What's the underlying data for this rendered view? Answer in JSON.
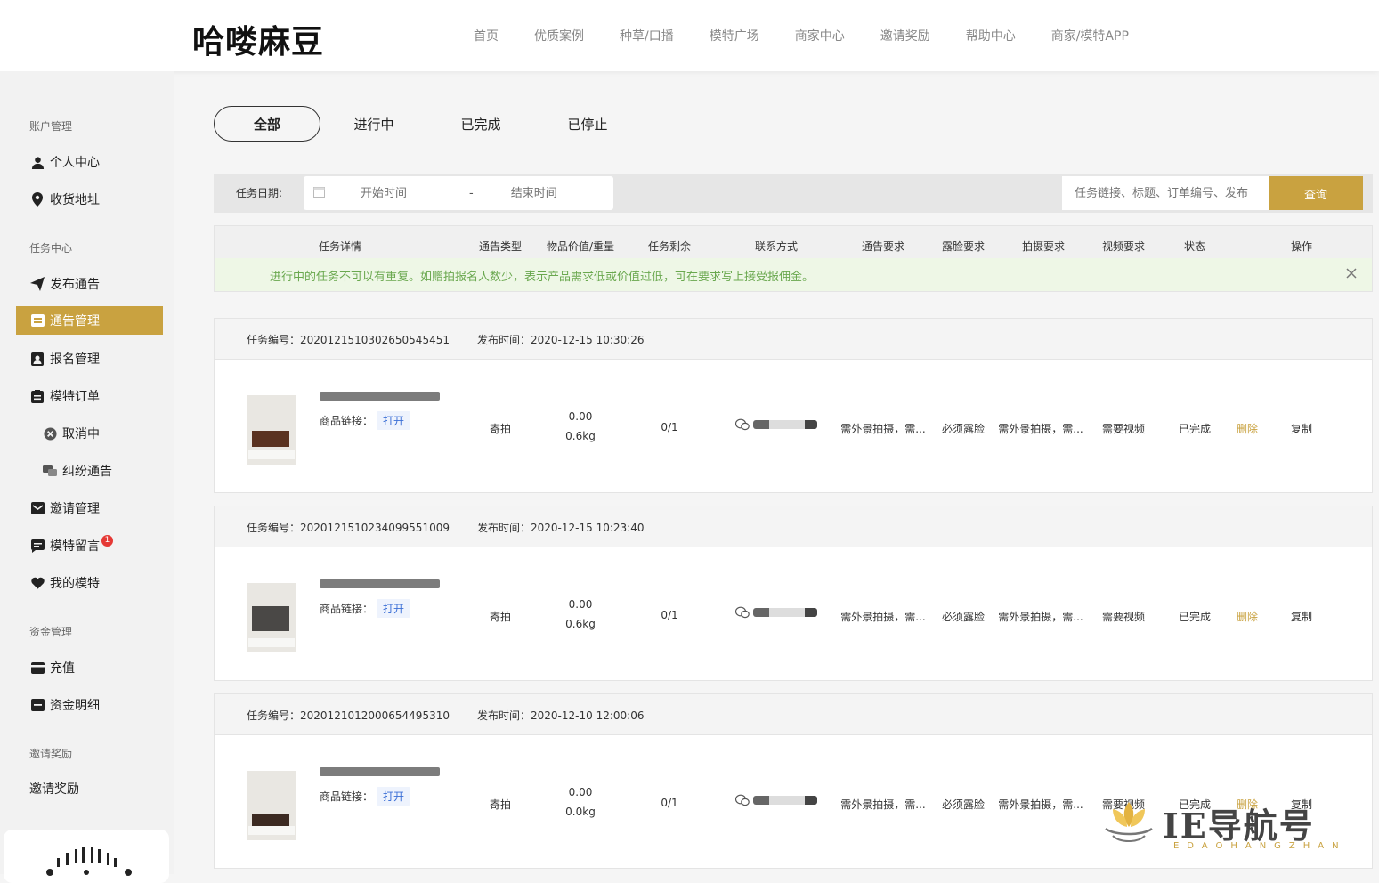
{
  "header": {
    "logo": "哈喽麻豆",
    "nav": [
      "首页",
      "优质案例",
      "种草/口播",
      "模特广场",
      "商家中心",
      "邀请奖励",
      "帮助中心",
      "商家/模特APP"
    ]
  },
  "sidebar": {
    "sec_account": "账户管理",
    "personal": "个人中心",
    "address": "收货地址",
    "sec_task": "任务中心",
    "publish": "发布通告",
    "manage": "通告管理",
    "signup": "报名管理",
    "orders": "模特订单",
    "cancelling": "取消中",
    "dispute": "纠纷通告",
    "invite_manage": "邀请管理",
    "messages": "模特留言",
    "messages_badge": "1",
    "my_models": "我的模特",
    "sec_funds": "资金管理",
    "recharge": "充值",
    "fund_detail": "资金明细",
    "sec_invite": "邀请奖励",
    "invite_reward": "邀请奖励"
  },
  "tabs": [
    "全部",
    "进行中",
    "已完成",
    "已停止"
  ],
  "filter": {
    "label": "任务日期:",
    "start_placeholder": "开始时间",
    "sep": "-",
    "end_placeholder": "结束时间",
    "search_placeholder": "任务链接、标题、订单编号、发布",
    "query": "查询"
  },
  "columns": [
    "任务详情",
    "通告类型",
    "物品价值/重量",
    "任务剩余",
    "联系方式",
    "通告要求",
    "露脸要求",
    "拍摄要求",
    "视频要求",
    "状态",
    "操作"
  ],
  "notice": "进行中的任务不可以有重复。如赠拍报名人数少，表示产品需求低或价值过低，可在要求写上接受报佣金。",
  "tasks": [
    {
      "no_label": "任务编号：",
      "no": "2020121510302650545451",
      "time_label": "发布时间：",
      "time": "2020-12-15 10:30:26",
      "link_label": "商品链接：",
      "open": "打开",
      "type": "寄拍",
      "value": "0.00",
      "weight": "0.6kg",
      "remain": "0/1",
      "req": "需外景拍摄，需...",
      "face": "必须露脸",
      "shoot": "需外景拍摄，需...",
      "video": "需要视频",
      "status": "已完成",
      "del": "删除",
      "copy": "复制"
    },
    {
      "no_label": "任务编号：",
      "no": "2020121510234099551009",
      "time_label": "发布时间：",
      "time": "2020-12-15 10:23:40",
      "link_label": "商品链接：",
      "open": "打开",
      "type": "寄拍",
      "value": "0.00",
      "weight": "0.6kg",
      "remain": "0/1",
      "req": "需外景拍摄，需...",
      "face": "必须露脸",
      "shoot": "需外景拍摄，需...",
      "video": "需要视频",
      "status": "已完成",
      "del": "删除",
      "copy": "复制"
    },
    {
      "no_label": "任务编号：",
      "no": "2020121012000654495310",
      "time_label": "发布时间：",
      "time": "2020-12-10 12:00:06",
      "link_label": "商品链接：",
      "open": "打开",
      "type": "寄拍",
      "value": "0.00",
      "weight": "0.0kg",
      "remain": "0/1",
      "req": "需外景拍摄，需...",
      "face": "必须露脸",
      "shoot": "需外景拍摄，需...",
      "video": "需要视频",
      "status": "已完成",
      "del": "删除",
      "copy": "复制"
    }
  ],
  "watermark": {
    "main": "IE导航号",
    "sub": "IEDAOHANGZHAN"
  },
  "colors": {
    "accent": "#c9a240",
    "notice_text": "#6aa84f",
    "link": "#3b6fd6"
  }
}
